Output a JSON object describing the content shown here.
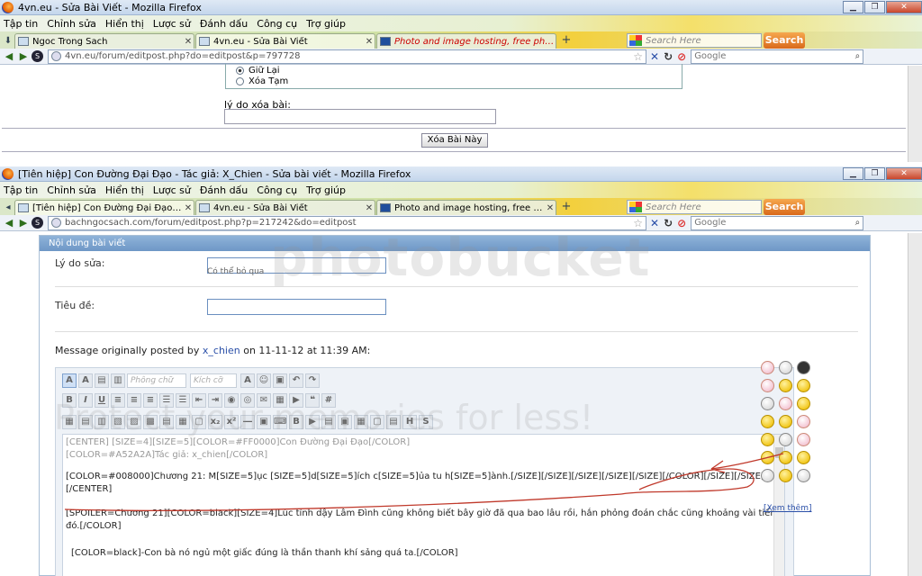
{
  "window1": {
    "title": "4vn.eu - Sửa Bài Viết - Mozilla Firefox",
    "menu": [
      "Tập tin",
      "Chỉnh sửa",
      "Hiển thị",
      "Lược sử",
      "Đánh dấu",
      "Công cụ",
      "Trợ giúp"
    ],
    "tabs": [
      {
        "label": "Ngoc Trong Sach"
      },
      {
        "label": "4vn.eu - Sửa Bài Viết"
      },
      {
        "label": "Photo and image hosting, free photo ..."
      }
    ],
    "search_placeholder": "Search Here",
    "search_button": "Search",
    "url": "4vn.eu/forum/editpost.php?do=editpost&p=797728",
    "google_placeholder": "Google",
    "radio_keep": "Giữ Lại",
    "radio_temp_delete": "Xóa Tạm",
    "reason_label": "lý do xóa bài:",
    "delete_button": "Xóa Bài Này"
  },
  "window2": {
    "title": "[Tiên hiệp] Con Đường Đại Đạo - Tác giả: X_Chien - Sửa bài viết - Mozilla Firefox",
    "menu": [
      "Tập tin",
      "Chỉnh sửa",
      "Hiển thị",
      "Lược sử",
      "Đánh dấu",
      "Công cụ",
      "Trợ giúp"
    ],
    "tabs": [
      {
        "label": "[Tiên hiệp] Con Đường Đại Đạo - Tác ..."
      },
      {
        "label": "4vn.eu - Sửa Bài Viết"
      },
      {
        "label": "Photo and image hosting, free photo ..."
      }
    ],
    "search_placeholder": "Search Here",
    "search_button": "Search",
    "url": "bachngocsach.com/forum/editpost.php?p=217242&do=editpost",
    "google_placeholder": "Google",
    "panel_title": "Nội dung bài viết",
    "edit_reason_label": "Lý do sửa:",
    "edit_reason_hint": "Có thể bỏ qua",
    "title_label": "Tiêu đề:",
    "posted_prefix": "Message originally posted by",
    "posted_user": "x_chien",
    "posted_suffix": "on 11-11-12 at 11:39 AM:",
    "font_select": "Phông chữ",
    "size_select": "Kích cỡ",
    "editor_lines": [
      "[CENTER]  [SIZE=4][SIZE=5][COLOR=#FF0000]Con Đường Đại Đạo[/COLOR]",
      "[COLOR=#A52A2A]Tác giả: x_chien[/COLOR]",
      "[COLOR=#008000]Chương 21: M[SIZE=5]ục [SIZE=5]d[SIZE=5]ích c[SIZE=5]ủa tu h[SIZE=5]ành.[/SIZE][/SIZE][/SIZE][/SIZE][/SIZE][/COLOR][/SIZE][/SIZE]",
      "[/CENTER]",
      "[SPOILER=Chương 21][COLOR=black][SIZE=4]Lúc tỉnh dậy Lâm Đình cũng không biết bây giờ đã qua bao lâu rồi, hắn phỏng đoán chắc cũng khoảng vài tiếng gì",
      "đó.[/COLOR]",
      "[COLOR=black]-Con bà nó ngủ một giấc đúng là thần thanh khí sảng quá ta.[/COLOR]"
    ],
    "more_smilies": "[Xem thêm]"
  },
  "watermark": {
    "line1": "photobucket",
    "line2": "Protect your memories for less!"
  }
}
